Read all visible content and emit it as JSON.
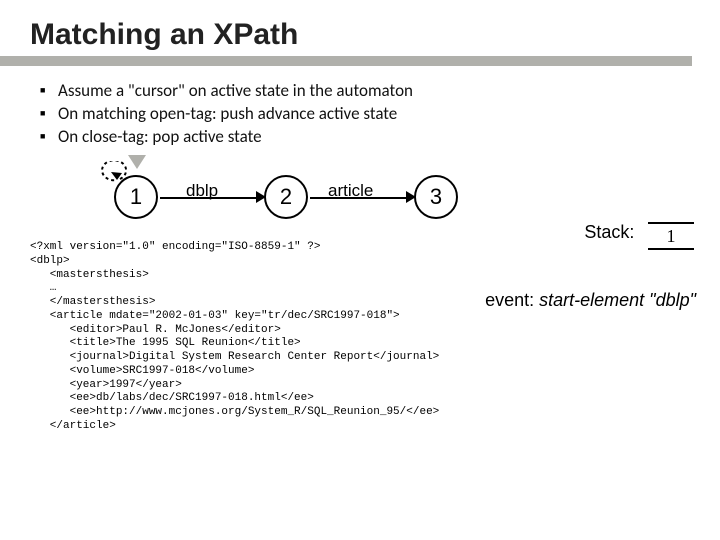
{
  "title": "Matching an XPath",
  "bullets": [
    "Assume a \"cursor\" on active state in the automaton",
    "On matching open-tag:  push advance active state",
    "On close-tag:  pop active state"
  ],
  "automaton": {
    "nodes": {
      "n1": "1",
      "n2": "2",
      "n3": "3"
    },
    "edges": {
      "e1": "dblp",
      "e2": "article"
    }
  },
  "stack": {
    "label": "Stack:",
    "value": "1"
  },
  "event": {
    "prefix": "event:  ",
    "text": "start-element \"dblp\""
  },
  "xml": "<?xml version=\"1.0\" encoding=\"ISO-8859-1\" ?>\n<dblp>\n   <mastersthesis>\n   …\n   </mastersthesis>\n   <article mdate=\"2002-01-03\" key=\"tr/dec/SRC1997-018\">\n      <editor>Paul R. McJones</editor>\n      <title>The 1995 SQL Reunion</title>\n      <journal>Digital System Research Center Report</journal>\n      <volume>SRC1997-018</volume>\n      <year>1997</year>\n      <ee>db/labs/dec/SRC1997-018.html</ee>\n      <ee>http://www.mcjones.org/System_R/SQL_Reunion_95/</ee>\n   </article>"
}
